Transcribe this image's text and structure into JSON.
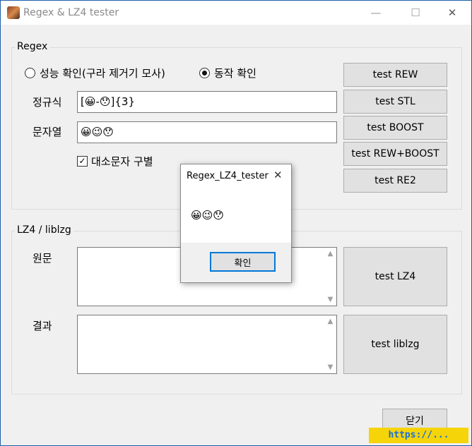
{
  "window": {
    "title": "Regex & LZ4 tester",
    "min_glyph": "—",
    "max_glyph": "☐",
    "close_glyph": "✕"
  },
  "regex": {
    "group_label": "Regex",
    "radio_perf": "성능 확인(구라 제거기 모사)",
    "radio_action": "동작 확인",
    "selected_radio": "동작 확인",
    "pattern_label": "정규식",
    "pattern_value": "[😀-😯]{3}",
    "string_label": "문자열",
    "string_value": "😀😉😯",
    "case_checkbox_label": "대소문자 구별",
    "case_checked": true,
    "buttons": [
      "test REW",
      "test STL",
      "test BOOST",
      "test REW+BOOST",
      "test RE2"
    ]
  },
  "lz4": {
    "group_label": "LZ4 / liblzg",
    "source_label": "원문",
    "result_label": "결과",
    "test_lz4": "test LZ4",
    "test_liblzg": "test liblzg"
  },
  "close_button": "닫기",
  "dialog": {
    "title": "Regex_LZ4_tester",
    "message": "😀😉😯",
    "ok": "확인"
  },
  "watermark": "https://..."
}
